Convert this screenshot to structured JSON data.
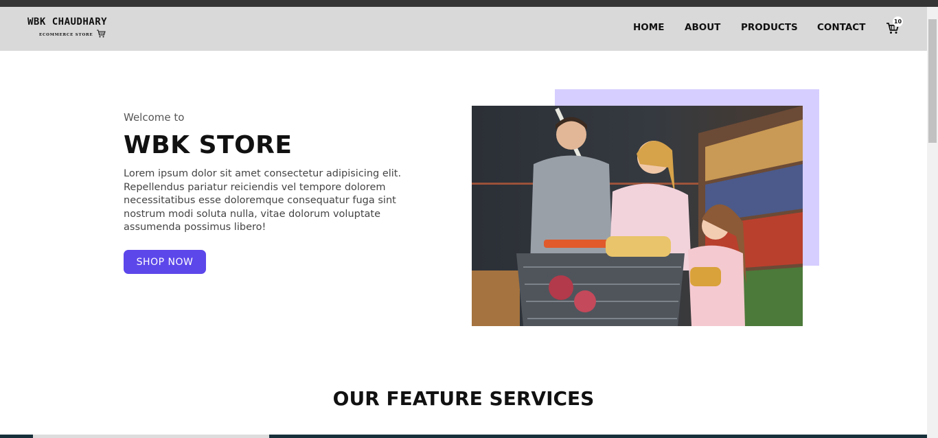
{
  "brand": {
    "name": "WBK CHAUDHARY",
    "tagline": "ECOMMERCE STORE"
  },
  "nav": {
    "items": [
      {
        "label": "HOME"
      },
      {
        "label": "ABOUT"
      },
      {
        "label": "PRODUCTS"
      },
      {
        "label": "CONTACT"
      }
    ],
    "cart_count": "10",
    "cart_icon": "shopping-cart-icon"
  },
  "hero": {
    "welcome": "Welcome to",
    "title": "WBK STORE",
    "text": "Lorem ipsum dolor sit amet consectetur adipisicing elit. Repellendus pariatur reiciendis vel tempore dolorem necessitatibus esse doloremque consequatur fuga sint nostrum modi soluta nulla, vitae dolorum voluptate assumenda possimus libero!",
    "button_label": "SHOP NOW",
    "accent_color": "#d6ceff",
    "button_color": "#5c47ea"
  },
  "features": {
    "title": "OUR FEATURE SERVICES"
  }
}
